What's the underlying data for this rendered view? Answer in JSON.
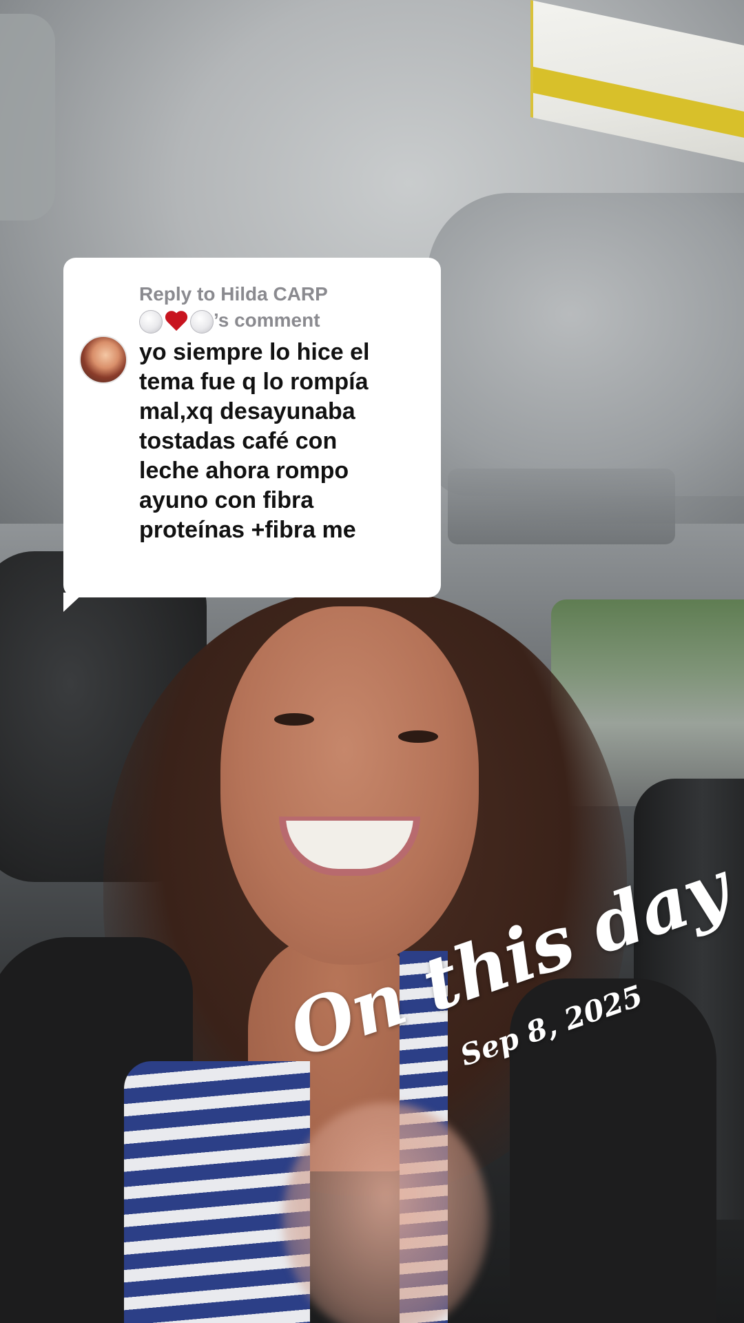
{
  "reply_card": {
    "header_prefix": "Reply to Hilda CARP",
    "header_suffix": "’s comment",
    "header_emojis": [
      "white-circle",
      "red-heart",
      "white-circle"
    ],
    "comment": "yo siempre lo hice el\ntema fue q lo rompía\nmal,xq desayunaba\ntostadas café con\nleche ahora rompo\nayuno con fibra\nproteínas +fibra me"
  },
  "memory_overlay": {
    "title": "On this day",
    "date": "Sep 8, 2025"
  },
  "colors": {
    "card_background": "#ffffff",
    "header_text": "#8a8a8f",
    "comment_text": "#111111",
    "overlay_text": "#ffffff"
  }
}
